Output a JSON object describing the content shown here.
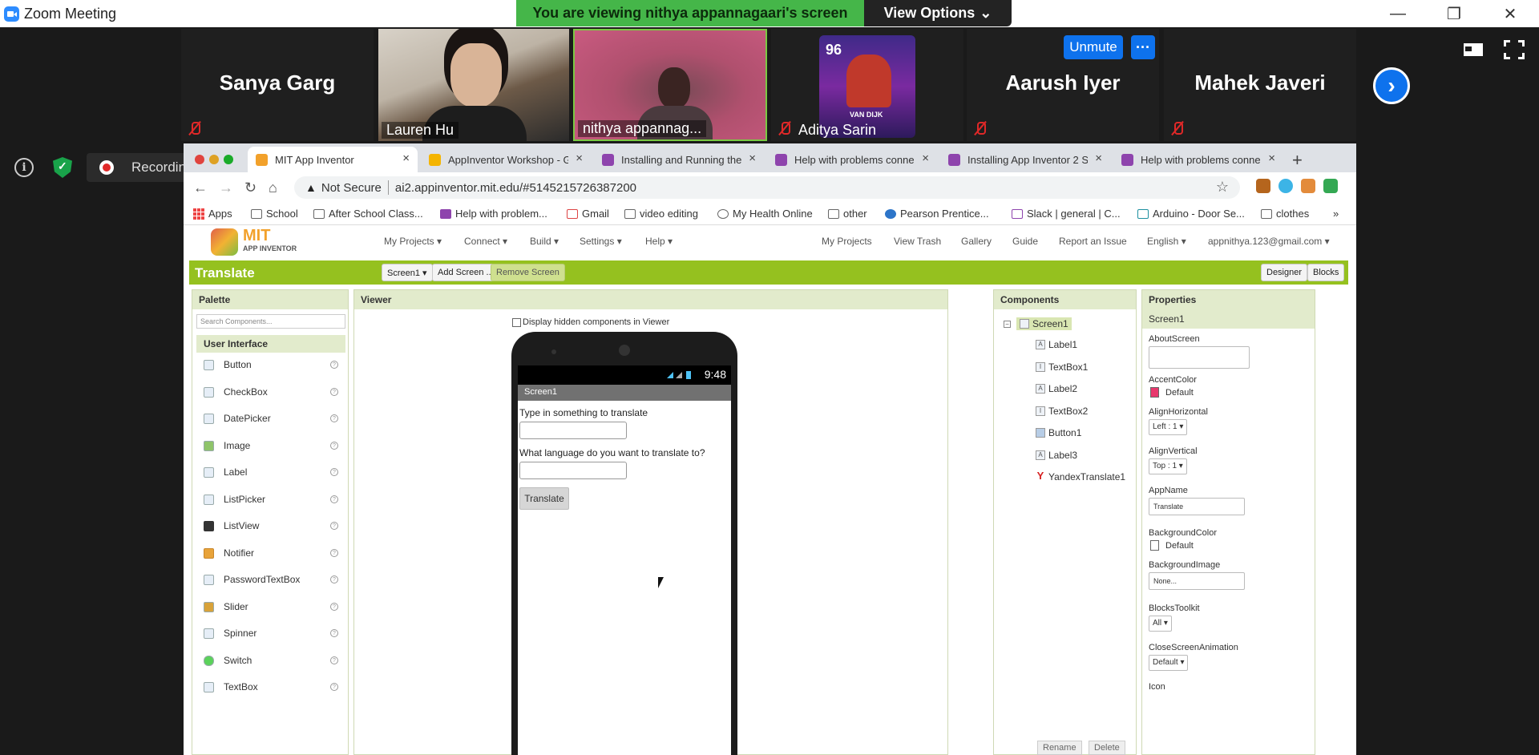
{
  "zoom": {
    "window_title": "Zoom Meeting",
    "banner": "You are viewing nithya appannagaari's screen",
    "view_options": "View Options",
    "unmute": "Unmute",
    "more": "···",
    "recording": "Recording...",
    "participants": [
      {
        "name": "Sanya Garg",
        "type": "name"
      },
      {
        "name": "Lauren Hu",
        "type": "video"
      },
      {
        "name": "nithya appannag...",
        "type": "video"
      },
      {
        "name": "Aditya Sarin",
        "type": "avatar"
      },
      {
        "name": "Aarush Iyer",
        "type": "name"
      },
      {
        "name": "Mahek Javeri",
        "type": "name"
      }
    ],
    "card_rating": "96",
    "card_name": "VAN DIJK"
  },
  "browser": {
    "tabs": [
      {
        "label": "MIT App Inventor",
        "color": "#f2a12b"
      },
      {
        "label": "AppInventor Workshop - G",
        "color": "#f4b400"
      },
      {
        "label": "Installing and Running the",
        "color": "#8e44ad"
      },
      {
        "label": "Help with problems conne",
        "color": "#8e44ad"
      },
      {
        "label": "Installing App Inventor 2 S",
        "color": "#8e44ad"
      },
      {
        "label": "Help with problems conne",
        "color": "#8e44ad"
      }
    ],
    "not_secure": "Not Secure",
    "url": "ai2.appinventor.mit.edu/#5145215726387200",
    "bookmarks": [
      "Apps",
      "School",
      "After School Class...",
      "Help with problem...",
      "Gmail",
      "video editing",
      "My Health Online",
      "other",
      "Pearson Prentice...",
      "Slack | general | C...",
      "Arduino - Door Se...",
      "clothes",
      "»"
    ]
  },
  "appinventor": {
    "logo_title": "MIT",
    "logo_sub": "APP INVENTOR",
    "menu_left": [
      "My Projects ▾",
      "Connect ▾",
      "Build ▾",
      "Settings ▾",
      "Help ▾"
    ],
    "menu_right": [
      "My Projects",
      "View Trash",
      "Gallery",
      "Guide",
      "Report an Issue",
      "English ▾",
      "appnithya.123@gmail.com ▾"
    ],
    "project_name": "Translate",
    "screen_select": "Screen1 ▾",
    "add_screen": "Add Screen ...",
    "remove_screen": "Remove Screen",
    "designer": "Designer",
    "blocks": "Blocks",
    "palette": {
      "title": "Palette",
      "search_placeholder": "Search Components...",
      "section": "User Interface",
      "items": [
        "Button",
        "CheckBox",
        "DatePicker",
        "Image",
        "Label",
        "ListPicker",
        "ListView",
        "Notifier",
        "PasswordTextBox",
        "Slider",
        "Spinner",
        "Switch",
        "TextBox"
      ]
    },
    "viewer": {
      "title": "Viewer",
      "hidden_components": "Display hidden components in Viewer",
      "time": "9:48",
      "screen_title": "Screen1",
      "label1": "Type in something to translate",
      "label2": "What language do you want to translate to?",
      "button": "Translate"
    },
    "components": {
      "title": "Components",
      "root": "Screen1",
      "children": [
        "Label1",
        "TextBox1",
        "Label2",
        "TextBox2",
        "Button1",
        "Label3",
        "YandexTranslate1"
      ],
      "rename": "Rename",
      "delete": "Delete"
    },
    "properties": {
      "title": "Properties",
      "selected": "Screen1",
      "about_screen": "AboutScreen",
      "accent_color": "AccentColor",
      "accent_value": "Default",
      "align_h": "AlignHorizontal",
      "align_h_value": "Left : 1 ▾",
      "align_v": "AlignVertical",
      "align_v_value": "Top : 1 ▾",
      "app_name": "AppName",
      "app_name_value": "Translate",
      "bg_color": "BackgroundColor",
      "bg_color_value": "Default",
      "bg_image": "BackgroundImage",
      "bg_image_value": "None...",
      "blocks_toolkit": "BlocksToolkit",
      "blocks_toolkit_value": "All ▾",
      "close_anim": "CloseScreenAnimation",
      "close_anim_value": "Default ▾",
      "icon": "Icon"
    }
  }
}
